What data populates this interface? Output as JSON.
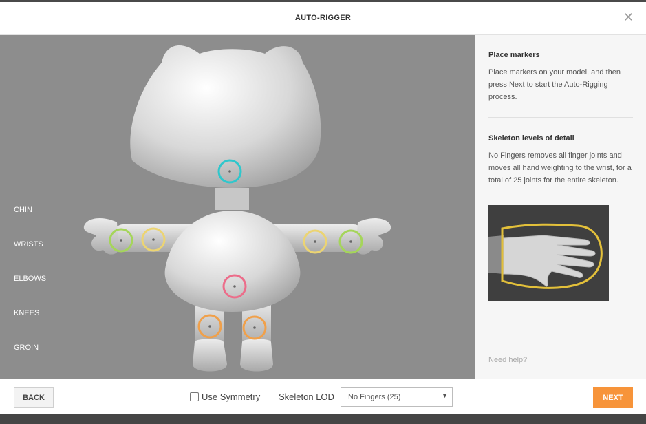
{
  "dialog": {
    "title": "AUTO-RIGGER",
    "close_glyph": "✕"
  },
  "markers": {
    "items": [
      {
        "label": "CHIN",
        "color": "#2fc7cc"
      },
      {
        "label": "WRISTS",
        "color": "#a5d55a"
      },
      {
        "label": "ELBOWS",
        "color": "#ecd472"
      },
      {
        "label": "KNEES",
        "color": "#f0a04a"
      },
      {
        "label": "GROIN",
        "color": "#ec6d8a"
      }
    ]
  },
  "sidebar": {
    "place_heading": "Place markers",
    "place_text": "Place markers on your model, and then press Next to start the Auto-Rigging process.",
    "lod_heading": "Skeleton levels of detail",
    "lod_text": "No Fingers removes all finger joints and moves all hand weighting to the wrist, for a total of 25 joints for the entire skeleton.",
    "help_link": "Need help?"
  },
  "footer": {
    "back_label": "BACK",
    "symmetry_label": "Use Symmetry",
    "symmetry_checked": false,
    "lod_label": "Skeleton LOD",
    "lod_selected": "No Fingers (25)",
    "next_label": "NEXT",
    "accent_color": "#f7943a"
  }
}
